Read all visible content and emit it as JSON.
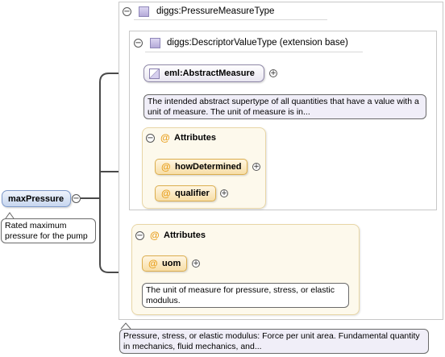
{
  "root_type": {
    "name": "diggs:PressureMeasureType"
  },
  "extension": {
    "name": "diggs:DescriptorValueType (extension base)"
  },
  "abstract_measure": {
    "name": "eml:AbstractMeasure",
    "doc": "The intended abstract supertype of all quantities that have a value with a unit of measure. The unit of measure is in..."
  },
  "inner_attributes": {
    "header": "Attributes",
    "items": [
      "howDetermined",
      "qualifier"
    ]
  },
  "outer_attributes": {
    "header": "Attributes",
    "uom": {
      "name": "uom",
      "doc": "The unit of measure for pressure, stress, or elastic modulus."
    }
  },
  "element": {
    "name": "maxPressure",
    "doc": "Rated maximum pressure for the pump"
  },
  "type_doc": "Pressure, stress, or elastic modulus: Force per unit area. Fundamental quantity in mechanics, fluid mechanics, and...",
  "symbols": {
    "collapse": "−",
    "expand": "+",
    "attribute": "@"
  },
  "colors": {
    "type_icon": "#b4aad8",
    "attribute_fill": "#f7dea7",
    "attribute_group_bg": "#fdf9ec",
    "element_fill": "#c7d6ef",
    "at_symbol": "#e8a020"
  }
}
